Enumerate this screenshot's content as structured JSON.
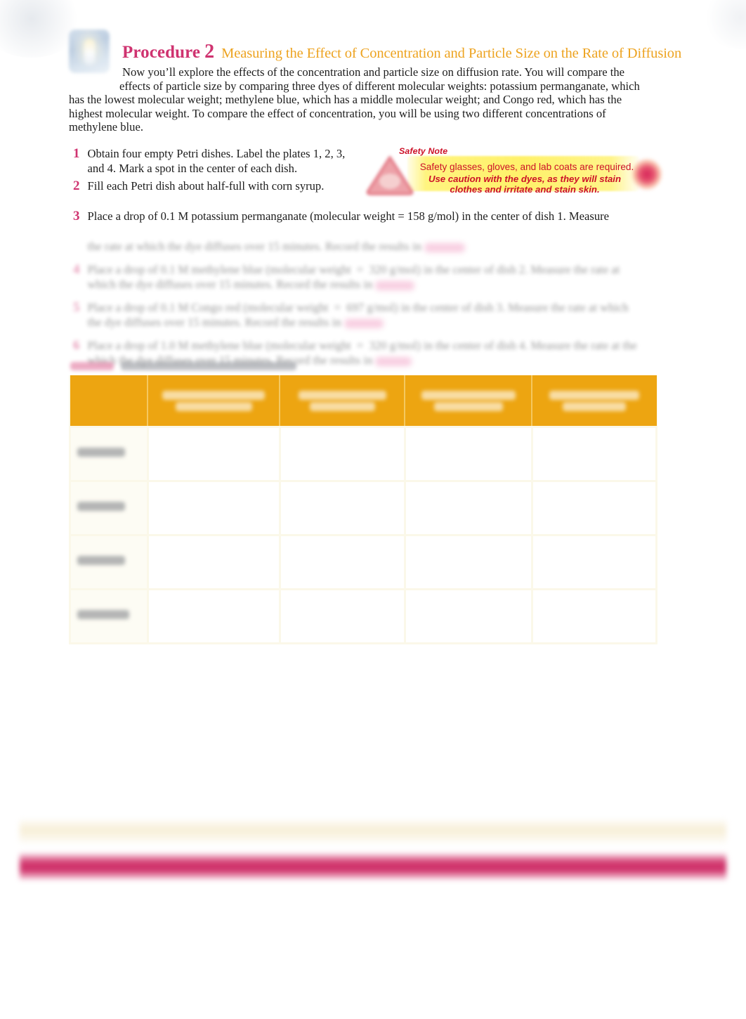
{
  "header": {
    "procedure_word": "Procedure",
    "procedure_number": "2",
    "procedure_subtitle": "Measuring the Effect of Concentration and Particle Size on the Rate of Diffusion",
    "icon_name": "petri-dish-icon",
    "accent_pink": "#cf3370",
    "accent_gold": "#eda320"
  },
  "intro": {
    "paragraph": "Now you’ll explore the effects of the concentration and particle size on diffusion rate. You will compare the effects of particle size by comparing three dyes of different molecular weights: potassium permanganate, which has the lowest molecular weight; methylene blue, which has a middle molecular weight; and Congo red, which has the highest molecular weight. To compare the effect of concentration, you will be using two different concentrations of methylene blue.",
    "line1": "Now you’ll explore the effects of the concentration and particle size on diffusion rate. You will compare the",
    "line2": "effects of particle size by comparing three dyes of different molecular weights: potassium permanganate, which",
    "line3": "has the lowest molecular weight; methylene blue, which has a middle molecular weight; and Congo red, which has the",
    "line4": "highest molecular weight. To compare the effect of concentration, you will be using two different concentrations of",
    "line5": "methylene blue."
  },
  "steps": [
    {
      "number": "1",
      "text": "Obtain four empty Petri dishes. Label the plates 1, 2, 3, and 4. Mark a spot in the center of each dish."
    },
    {
      "number": "2",
      "text": "Fill each Petri dish about half-full with corn syrup."
    },
    {
      "number": "3",
      "text": "Place a drop of 0.1 M potassium permanganate (molecular weight  =  158 g/mol) in the center of dish 1. Measure"
    }
  ],
  "blurred_steps": {
    "note": "illegible",
    "step3_continuation": "illegible",
    "step4": "illegible",
    "step5": "illegible",
    "step6": "illegible"
  },
  "safety": {
    "label": "Safety Note",
    "line1": "Safety glasses, gloves, and lab coats are required.",
    "line2": "Use caution with the dyes, as they will stain clothes and irritate and stain skin.",
    "line2a": "Use caution with the dyes, as they will stain",
    "line2b": "clothes and irritate and stain skin.",
    "icon_name": "warning-triangle-icon",
    "text_color": "#cc1128",
    "background_color": "#fff169"
  },
  "table": {
    "caption": "illegible",
    "header_color": "#eda511",
    "body_color": "#fbf8e9",
    "columns": [
      {
        "label": ""
      },
      {
        "label": "illegible"
      },
      {
        "label": "illegible"
      },
      {
        "label": "illegible"
      },
      {
        "label": "illegible"
      }
    ],
    "rows": [
      {
        "label": "illegible",
        "cells": [
          "",
          "",
          "",
          ""
        ]
      },
      {
        "label": "illegible",
        "cells": [
          "",
          "",
          "",
          ""
        ]
      },
      {
        "label": "illegible",
        "cells": [
          "",
          "",
          "",
          ""
        ]
      },
      {
        "label": "illegible",
        "cells": [
          "",
          "",
          "",
          ""
        ]
      }
    ]
  },
  "footer": {
    "bar_cream_color": "#f7eed6",
    "bar_crimson_color": "#d23a70"
  }
}
